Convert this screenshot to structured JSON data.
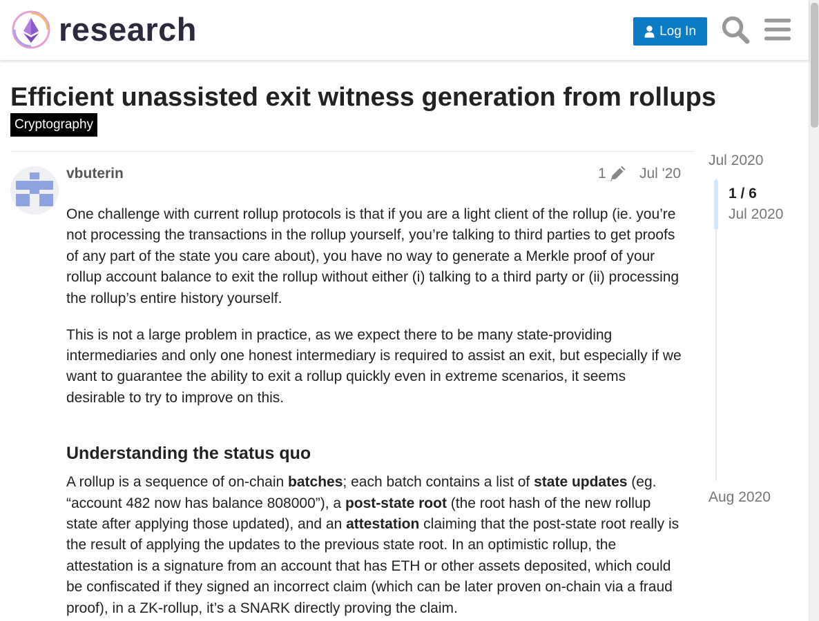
{
  "header": {
    "brand": "research",
    "login_label": "Log In"
  },
  "topic": {
    "title": "Efficient unassisted exit witness generation from rollups",
    "category": "Cryptography"
  },
  "post": {
    "username": "vbuterin",
    "edit_count": "1",
    "date": "Jul '20",
    "p1": "One challenge with current rollup protocols is that if you are a light client of the rollup (ie. you’re not processing the transactions in the rollup yourself, you’re talking to third parties to get proofs of any part of the state you care about), you have no way to generate a Merkle proof of your rollup account balance to exit the rollup without either (i) talking to a third party or (ii) processing the rollup’s entire history yourself.",
    "p2": "This is not a large problem in practice, as we expect there to be many state-providing intermediaries and only one honest intermediary is required to assist an exit, but especially if we want to guarantee the ability to exit a rollup quickly even in extreme scenarios, it seems desirable to try to improve on this.",
    "h_status_quo": "Understanding the status quo",
    "p3": {
      "t1": "A rollup is a sequence of on-chain ",
      "b1": "batches",
      "t2": "; each batch contains a list of ",
      "b2": "state updates",
      "t3": " (eg. “account 482 now has balance 808000”), a ",
      "b3": "post-state root",
      "t4": " (the root hash of the new rollup state after applying those updated), and an ",
      "b4": "attestation",
      "t5": " claiming that the post-state root really is the result of applying the updates to the previous state root. In an optimistic rollup, the attestation is a signature from an account that has ETH or other assets deposited, which could be confiscated if they signed an incorrect claim (which can be later proven on-chain via a fraud proof), in a ZK-rollup, it’s a SNARK directly proving the claim."
    }
  },
  "timeline": {
    "start": "Jul 2020",
    "position": "1 / 6",
    "position_date": "Jul 2020",
    "end": "Aug 2020"
  },
  "colors": {
    "accent": "#0a7bc4",
    "category_bg": "#000000",
    "timeline_handle": "#d1e9f7"
  },
  "icons": [
    "logo-icon",
    "user-icon",
    "search-icon",
    "hamburger-menu-icon",
    "pencil-icon",
    "avatar-icon"
  ]
}
